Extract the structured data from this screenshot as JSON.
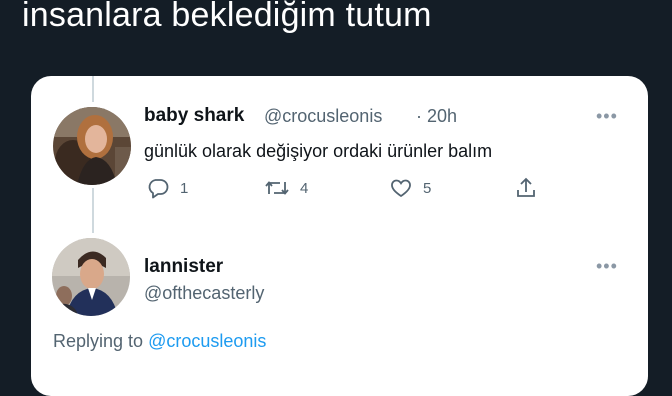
{
  "caption": "insanlara beklediğim tutum",
  "tweet1": {
    "name": "baby shark",
    "handle": "@crocusleonis",
    "time": "· 20h",
    "text": "günlük olarak değişiyor ordaki ürünler balım",
    "replies": "1",
    "retweets": "4",
    "likes": "5",
    "more": "•••"
  },
  "tweet2": {
    "name": "lannister",
    "handle": "@ofthecasterly",
    "replying_prefix": "Replying to",
    "replying_to": "@crocusleonis",
    "more": "•••"
  }
}
